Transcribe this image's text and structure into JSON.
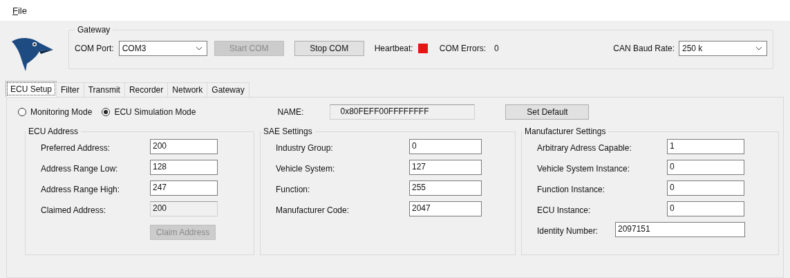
{
  "menu": [
    {
      "label": "File"
    }
  ],
  "gateway": {
    "title": "Gateway",
    "com_port_label": "COM Port:",
    "com_port": "COM3",
    "buttons": [
      {
        "label": "Start COM",
        "disabled": true
      },
      {
        "label": "Stop COM",
        "disabled": false
      }
    ],
    "heartbeat_label": "Heartbeat:",
    "heartbeat_ok": false,
    "errors_label": "COM Errors:",
    "errors": "0",
    "baud_label": "CAN Baud Rate:",
    "baud": "250 k"
  },
  "tabs": [
    {
      "label": "ECU Setup",
      "selected": true
    },
    {
      "label": "Filter",
      "selected": false
    },
    {
      "label": "Transmit",
      "selected": false
    },
    {
      "label": "Recorder",
      "selected": false
    },
    {
      "label": "Network",
      "selected": false
    },
    {
      "label": "Gateway",
      "selected": false
    }
  ],
  "modes": [
    {
      "label": "Monitoring Mode",
      "selected": false
    },
    {
      "label": "ECU Simulation Mode",
      "selected": true
    }
  ],
  "name_label": "NAME:",
  "name_value": "0x80FEFF00FFFFFFFF",
  "set_default": "Set Default",
  "groups": [
    {
      "title": "ECU Address",
      "fields": [
        {
          "label": "Preferred Address:",
          "value": "200",
          "disabled": false,
          "kind": "normal"
        },
        {
          "label": "Address Range Low:",
          "value": "128",
          "disabled": false,
          "kind": "normal"
        },
        {
          "label": "Address Range High:",
          "value": "247",
          "disabled": false,
          "kind": "normal"
        },
        {
          "label": "Claimed Address:",
          "value": "200",
          "disabled": true,
          "kind": "normal"
        }
      ],
      "button": {
        "label": "Claim Address",
        "disabled": true
      }
    },
    {
      "title": "SAE Settings",
      "fields": [
        {
          "label": "Industry Group:",
          "value": "0",
          "disabled": false,
          "kind": "normal"
        },
        {
          "label": "Vehicle System:",
          "value": "127",
          "disabled": false,
          "kind": "normal"
        },
        {
          "label": "Function:",
          "value": "255",
          "disabled": false,
          "kind": "normal"
        },
        {
          "label": "Manufacturer Code:",
          "value": "2047",
          "disabled": false,
          "kind": "normal"
        }
      ]
    },
    {
      "title": "Manufacturer Settings",
      "fields": [
        {
          "label": "Arbitrary Adress Capable:",
          "value": "1",
          "disabled": false,
          "kind": "normal"
        },
        {
          "label": "Vehicle System Instance:",
          "value": "0",
          "disabled": false,
          "kind": "normal"
        },
        {
          "label": "Function Instance:",
          "value": "0",
          "disabled": false,
          "kind": "normal"
        },
        {
          "label": "ECU Instance:",
          "value": "0",
          "disabled": false,
          "kind": "normal"
        },
        {
          "label": "Identity Number:",
          "value": "2097151",
          "disabled": false,
          "kind": "wide"
        }
      ]
    }
  ]
}
